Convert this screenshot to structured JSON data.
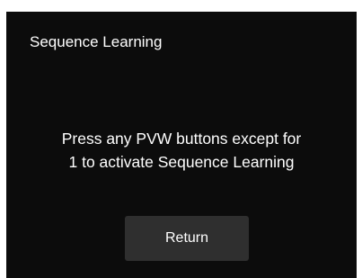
{
  "dialog": {
    "title": "Sequence Learning",
    "message_line1": "Press any PVW buttons except for",
    "message_line2": "1 to activate Sequence Learning",
    "return_label": "Return"
  },
  "colors": {
    "background": "#0c0c0c",
    "text": "#ffffff",
    "button": "#2f2f2f"
  }
}
